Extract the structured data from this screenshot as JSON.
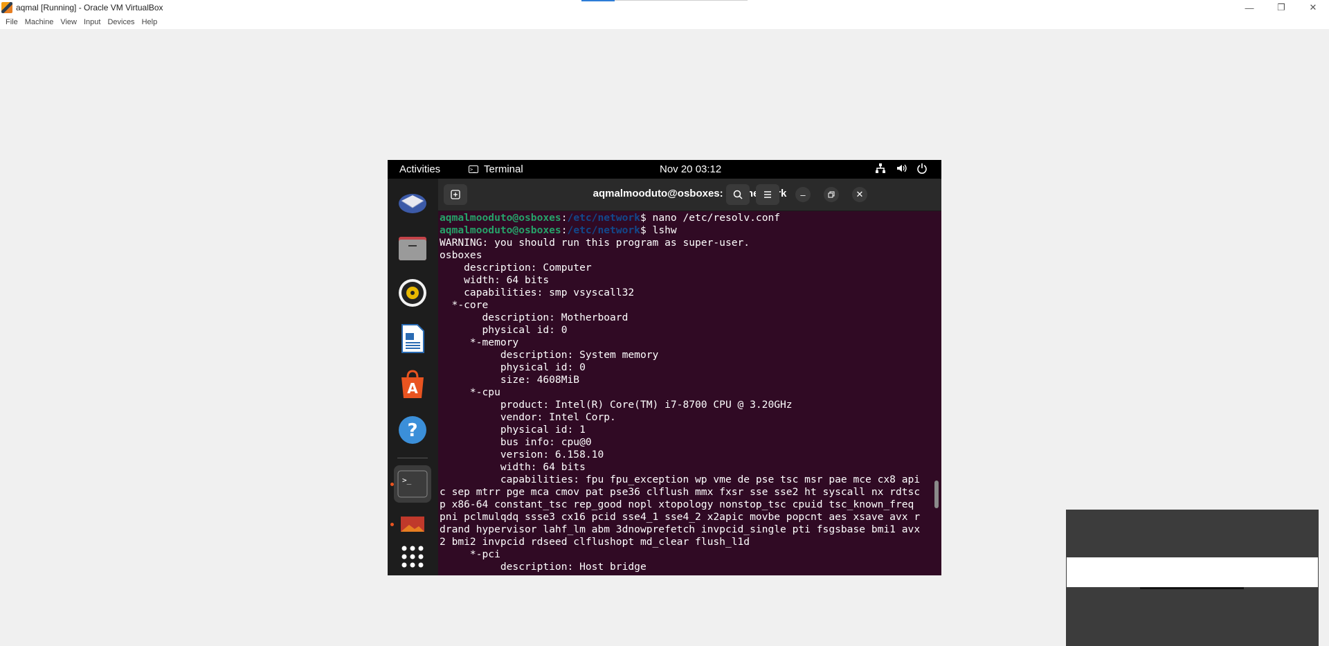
{
  "host": {
    "title": "aqmal [Running] - Oracle VM VirtualBox",
    "menu": [
      "File",
      "Machine",
      "View",
      "Input",
      "Devices",
      "Help"
    ],
    "controls": [
      "minimize",
      "restore",
      "close"
    ]
  },
  "gnome": {
    "activities": "Activities",
    "app_name": "Terminal",
    "clock": "Nov 20  03:12",
    "status_icons": [
      "network-icon",
      "volume-icon",
      "power-icon"
    ]
  },
  "dock": {
    "items": [
      "thunderbird",
      "files",
      "rhythmbox",
      "libreoffice-writer",
      "ubuntu-software",
      "help",
      "terminal",
      "shotwell",
      "show-apps"
    ],
    "active": "terminal"
  },
  "terminal": {
    "title": "aqmalmooduto@osboxes: /etc/network",
    "prompt_user": "aqmalmooduto@osboxes",
    "prompt_path": "/etc/network",
    "commands": [
      "$ nano /etc/resolv.conf",
      "$ lshw"
    ],
    "output": [
      "WARNING: you should run this program as super-user.",
      "osboxes",
      "    description: Computer",
      "    width: 64 bits",
      "    capabilities: smp vsyscall32",
      "  *-core",
      "       description: Motherboard",
      "       physical id: 0",
      "     *-memory",
      "          description: System memory",
      "          physical id: 0",
      "          size: 4608MiB",
      "     *-cpu",
      "          product: Intel(R) Core(TM) i7-8700 CPU @ 3.20GHz",
      "          vendor: Intel Corp.",
      "          physical id: 1",
      "          bus info: cpu@0",
      "          version: 6.158.10",
      "          width: 64 bits",
      "          capabilities: fpu fpu_exception wp vme de pse tsc msr pae mce cx8 api",
      "c sep mtrr pge mca cmov pat pse36 clflush mmx fxsr sse sse2 ht syscall nx rdtsc",
      "p x86-64 constant_tsc rep_good nopl xtopology nonstop_tsc cpuid tsc_known_freq",
      "pni pclmulqdq ssse3 cx16 pcid sse4_1 sse4_2 x2apic movbe popcnt aes xsave avx r",
      "drand hypervisor lahf_lm abm 3dnowprefetch invpcid_single pti fsgsbase bmi1 avx",
      "2 bmi2 invpcid rdseed clflushopt md_clear flush_l1d",
      "     *-pci",
      "          description: Host bridge"
    ]
  },
  "colors": {
    "terminal_bg": "#300a24",
    "prompt_user": "#26a269",
    "prompt_path": "#12488b",
    "accent": "#e95420"
  }
}
